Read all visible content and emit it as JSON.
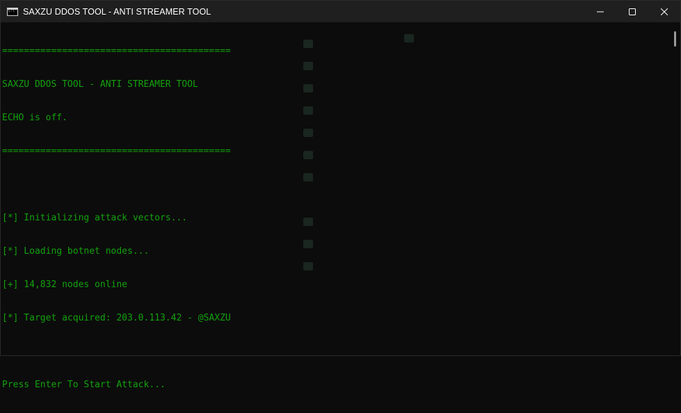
{
  "window": {
    "title": "SAXZU DDOS TOOL - ANTI STREAMER TOOL",
    "icon": "terminal-icon",
    "controls": [
      "minimize-icon",
      "maximize-icon",
      "close-icon"
    ]
  },
  "console": {
    "lines": [
      "==========================================",
      "SAXZU DDOS TOOL - ANTI STREAMER TOOL",
      "ECHO is off.",
      "==========================================",
      "",
      "[*] Initializing attack vectors...",
      "[*] Loading botnet nodes...",
      "[+] 14,832 nodes online",
      "[*] Target acquired: 203.0.113.42 - @SAXZU",
      "",
      "Press Enter To Start Attack..."
    ]
  },
  "colors": {
    "console_bg": "#0c0c0c",
    "console_text": "#13a10e",
    "titlebar_bg": "#1f1f1f",
    "titlebar_text": "#ffffff"
  }
}
